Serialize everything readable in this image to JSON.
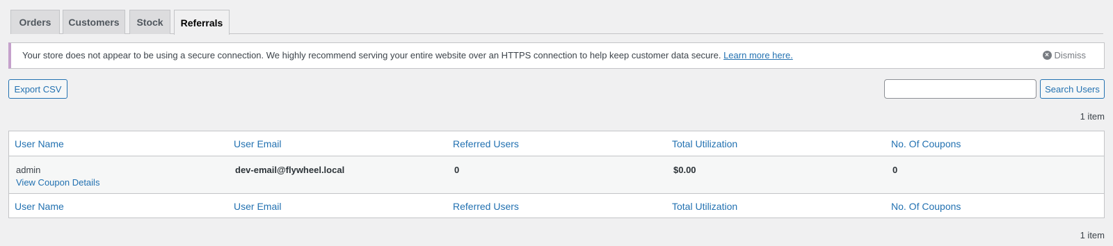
{
  "tabs": [
    {
      "label": "Orders"
    },
    {
      "label": "Customers"
    },
    {
      "label": "Stock"
    },
    {
      "label": "Referrals"
    }
  ],
  "notice": {
    "text": "Your store does not appear to be using a secure connection. We highly recommend serving your entire website over an HTTPS connection to help keep customer data secure.",
    "link": "Learn more here.",
    "dismiss": "Dismiss"
  },
  "toolbar": {
    "export_label": "Export CSV",
    "search_label": "Search Users",
    "search_value": ""
  },
  "count_top": "1 item",
  "count_bottom": "1 item",
  "table": {
    "columns": [
      "User Name",
      "User Email",
      "Referred Users",
      "Total Utilization",
      "No. Of Coupons"
    ],
    "rows": [
      {
        "user_name": "admin",
        "action": "View Coupon Details",
        "email": "dev-email@flywheel.local",
        "referred": "0",
        "utilization": "$0.00",
        "coupons": "0"
      }
    ]
  }
}
